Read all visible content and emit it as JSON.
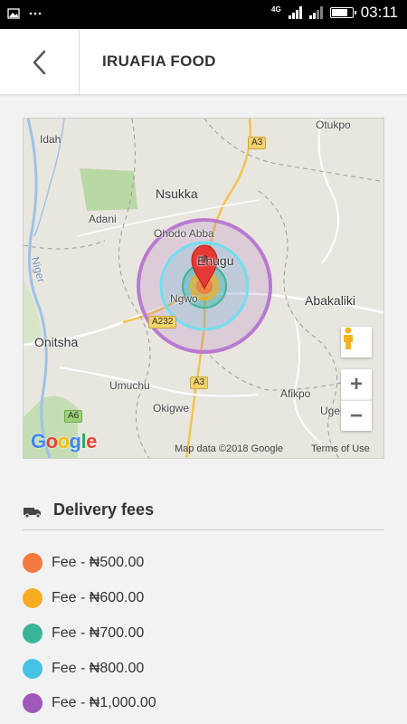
{
  "status_bar": {
    "time": "03:11",
    "network": "4G"
  },
  "app_bar": {
    "title": "IRUAFIA FOOD"
  },
  "map": {
    "labels": {
      "idah": "Idah",
      "otukpo": "Otukpo",
      "nsukka": "Nsukka",
      "adani": "Adani",
      "ohodo_abba": "Ohodo Abba",
      "enugu": "Enugu",
      "ngwo": "Ngwo",
      "niger": "Niger",
      "abakaliki": "Abakaliki",
      "onitsha": "Onitsha",
      "umuchu": "Umuchu",
      "okigwe": "Okigwe",
      "afikpo": "Afikpo",
      "ugep": "Ugep"
    },
    "shields": {
      "a3_top": "A3",
      "a232": "A232",
      "a3_bottom": "A3",
      "a6": "A6"
    },
    "google": "Google",
    "attribution": "Map data ©2018 Google",
    "terms": "Terms of Use",
    "zoom_in": "+",
    "zoom_out": "−"
  },
  "delivery": {
    "header": "Delivery fees",
    "fees": [
      {
        "label": "Fee - ₦500.00",
        "color": "#f47a3f"
      },
      {
        "label": "Fee - ₦600.00",
        "color": "#f5ad22"
      },
      {
        "label": "Fee - ₦700.00",
        "color": "#3bb59a"
      },
      {
        "label": "Fee - ₦800.00",
        "color": "#45c2e6"
      },
      {
        "label": "Fee - ₦1,000.00",
        "color": "#a059b8"
      }
    ]
  }
}
